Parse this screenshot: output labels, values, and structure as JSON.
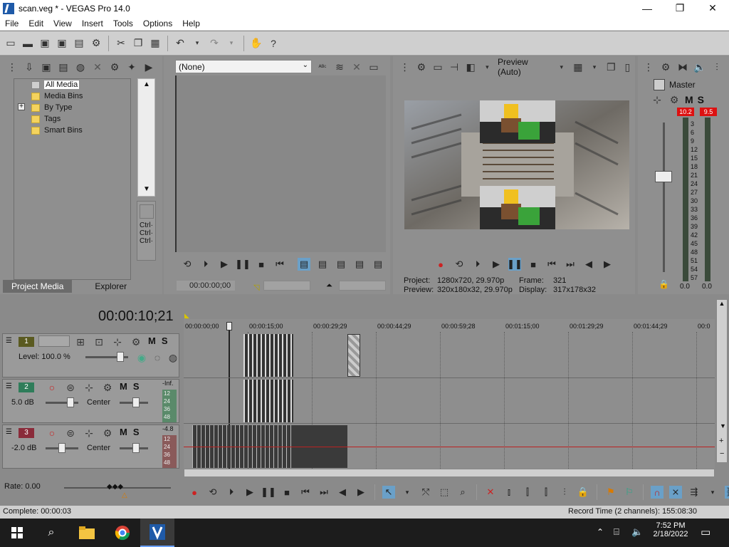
{
  "window": {
    "title": "scan.veg * - VEGAS Pro 14.0"
  },
  "menu": [
    "File",
    "Edit",
    "View",
    "Insert",
    "Tools",
    "Options",
    "Help"
  ],
  "project_media": {
    "tree": [
      "All Media",
      "Media Bins",
      "By Type",
      "Tags",
      "Smart Bins"
    ],
    "expand_marker": "+",
    "tabs": [
      "Project Media",
      "Explorer"
    ],
    "shortcuts": [
      "Ctrl·",
      "Ctrl·",
      "Ctrl·"
    ]
  },
  "trimmer": {
    "select": "(None)",
    "timecode": "00:00:00;00"
  },
  "preview": {
    "quality": "Preview (Auto)",
    "project_label": "Project:",
    "project_value": "1280x720, 29.970p",
    "preview_label": "Preview:",
    "preview_value": "320x180x32, 29.970p",
    "frame_label": "Frame:",
    "frame_value": "321",
    "display_label": "Display:",
    "display_value": "317x178x32"
  },
  "master": {
    "title": "Master",
    "peak_left": "10.2",
    "peak_right": "9.5",
    "scale": [
      "3",
      "6",
      "9",
      "12",
      "15",
      "18",
      "21",
      "24",
      "27",
      "30",
      "33",
      "36",
      "39",
      "42",
      "45",
      "48",
      "51",
      "54",
      "57"
    ],
    "bottom_left": "0.0",
    "bottom_right": "0.0"
  },
  "timeline": {
    "current_time": "00:00:10;21",
    "ruler": [
      "00:00:00;00",
      "00:00:15;00",
      "00:00:29;29",
      "00:00:44;29",
      "00:00:59;28",
      "00:01:15;00",
      "00:01:29;29",
      "00:01:44;29",
      "00:0"
    ],
    "tracks": [
      {
        "number": "1",
        "label": "Level: 100.0 %"
      },
      {
        "number": "2",
        "label": "5.0 dB",
        "pan": "Center",
        "top_db": "-Inf.",
        "levels": [
          "12",
          "24",
          "36",
          "48"
        ]
      },
      {
        "number": "3",
        "label": "-2.0 dB",
        "pan": "Center",
        "top_db": "-4.8",
        "levels": [
          "12",
          "24",
          "36",
          "48"
        ]
      }
    ],
    "rate": "Rate: 0.00"
  },
  "status": {
    "complete": "Complete: 00:00:03",
    "record_time": "Record Time (2 channels): 155:08:30"
  },
  "taskbar": {
    "time": "7:52 PM",
    "date": "2/18/2022"
  },
  "colors": {
    "peak": "#dd1111",
    "track1": "#c9b94a",
    "track2": "#2f7d5a",
    "track3": "#8a2b3a"
  }
}
